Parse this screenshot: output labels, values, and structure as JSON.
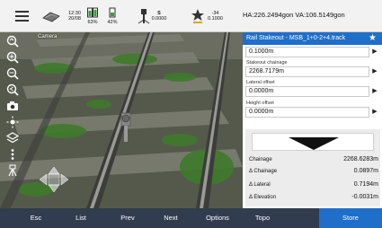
{
  "status": {
    "time": "12:30",
    "date": "20/08",
    "battery1": "63%",
    "battery2": "42%",
    "radio_label": "S",
    "radio_value": "0.0000",
    "gnss_count": "-34",
    "gnss_value": "0.1000",
    "ha_va": "HA:226.2494gon  VA:106.5149gon"
  },
  "camera": {
    "name": "Camera"
  },
  "panel": {
    "title": "Rail Stakeout - MSB_1+0-2+4.track",
    "fields": [
      {
        "label": "",
        "value": "0.1000m"
      },
      {
        "label": "Stakeout chainage",
        "value": "2268.7179m"
      },
      {
        "label": "Lateral offset",
        "value": "0.0000m"
      },
      {
        "label": "Height offset",
        "value": "0.0000m"
      }
    ],
    "results": [
      {
        "label": "Chainage",
        "value": "2268.6283m"
      },
      {
        "label": "Δ Chainage",
        "value": "0.0897m"
      },
      {
        "label": "Δ Lateral",
        "value": "0.7194m"
      },
      {
        "label": "Δ Elevation",
        "value": "-0.0031m"
      }
    ]
  },
  "buttons": {
    "esc": "Esc",
    "list": "List",
    "prev": "Prev",
    "next": "Next",
    "options": "Options",
    "topo": "Topo",
    "store": "Store"
  },
  "colors": {
    "accent": "#1f6ec9",
    "bottom_bar": "#313c4f",
    "top_bar": "#f2f2f2"
  }
}
